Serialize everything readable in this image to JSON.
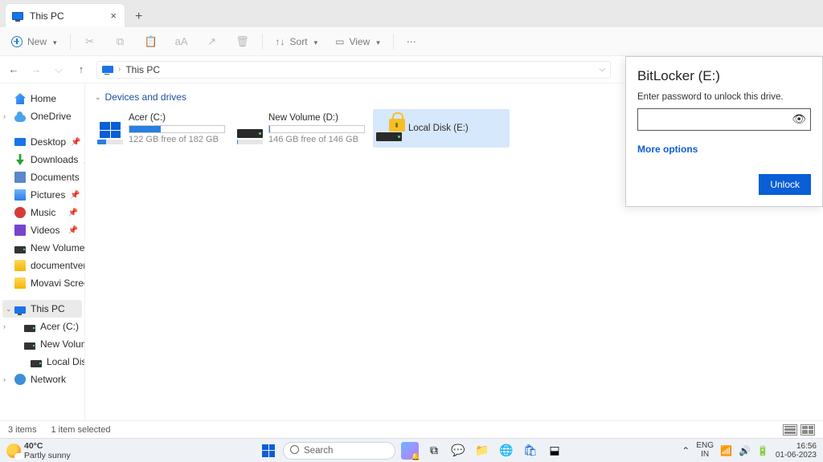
{
  "tab": {
    "title": "This PC",
    "close": "×",
    "new": "+"
  },
  "toolbar": {
    "new_label": "New",
    "sort_label": "Sort",
    "view_label": "View",
    "icons": {
      "cut": "✂",
      "copy": "⧉",
      "paste": "📋",
      "rename": "aA",
      "share": "↗",
      "delete": "🗑",
      "dots": "⋯"
    }
  },
  "addr": {
    "location": "This PC",
    "chev": "›",
    "drop": "⌵"
  },
  "sidebar": {
    "home": "Home",
    "onedrive": "OneDrive",
    "items": [
      {
        "label": "Desktop",
        "icon": "ico-desktop",
        "pin": true
      },
      {
        "label": "Downloads",
        "icon": "ico-dl",
        "pin": true
      },
      {
        "label": "Documents",
        "icon": "ico-doc",
        "pin": true
      },
      {
        "label": "Pictures",
        "icon": "ico-folder blue",
        "pin": true
      },
      {
        "label": "Music",
        "icon": "ico-music",
        "pin": true
      },
      {
        "label": "Videos",
        "icon": "ico-video",
        "pin": true
      },
      {
        "label": "New Volume (D:)",
        "icon": "ico-drive",
        "pin": false
      },
      {
        "label": "documentverification",
        "icon": "ico-folder",
        "pin": false
      },
      {
        "label": "Movavi Screen Recorder",
        "icon": "ico-folder",
        "pin": false
      }
    ],
    "thispc": "This PC",
    "drives": [
      {
        "label": "Acer (C:)"
      },
      {
        "label": "New Volume (D:)"
      },
      {
        "label": "Local Disk (E:)"
      }
    ],
    "network": "Network"
  },
  "content": {
    "group": "Devices and drives",
    "drive_c": {
      "name": "Acer (C:)",
      "free": "122 GB free of 182 GB",
      "fill_pct": 33
    },
    "drive_d": {
      "name": "New Volume (D:)",
      "free": "146 GB free of 146 GB",
      "fill_pct": 1
    },
    "drive_e": {
      "name": "Local Disk (E:)"
    }
  },
  "status": {
    "count": "3 items",
    "sel": "1 item selected"
  },
  "bitlocker": {
    "title": "BitLocker (E:)",
    "sub": "Enter password to unlock this drive.",
    "more": "More options",
    "unlock": "Unlock"
  },
  "taskbar": {
    "temp": "40°C",
    "weather": "Partly sunny",
    "search": "Search",
    "lang_top": "ENG",
    "lang_bot": "IN",
    "time": "16:56",
    "date": "01-06-2023"
  }
}
